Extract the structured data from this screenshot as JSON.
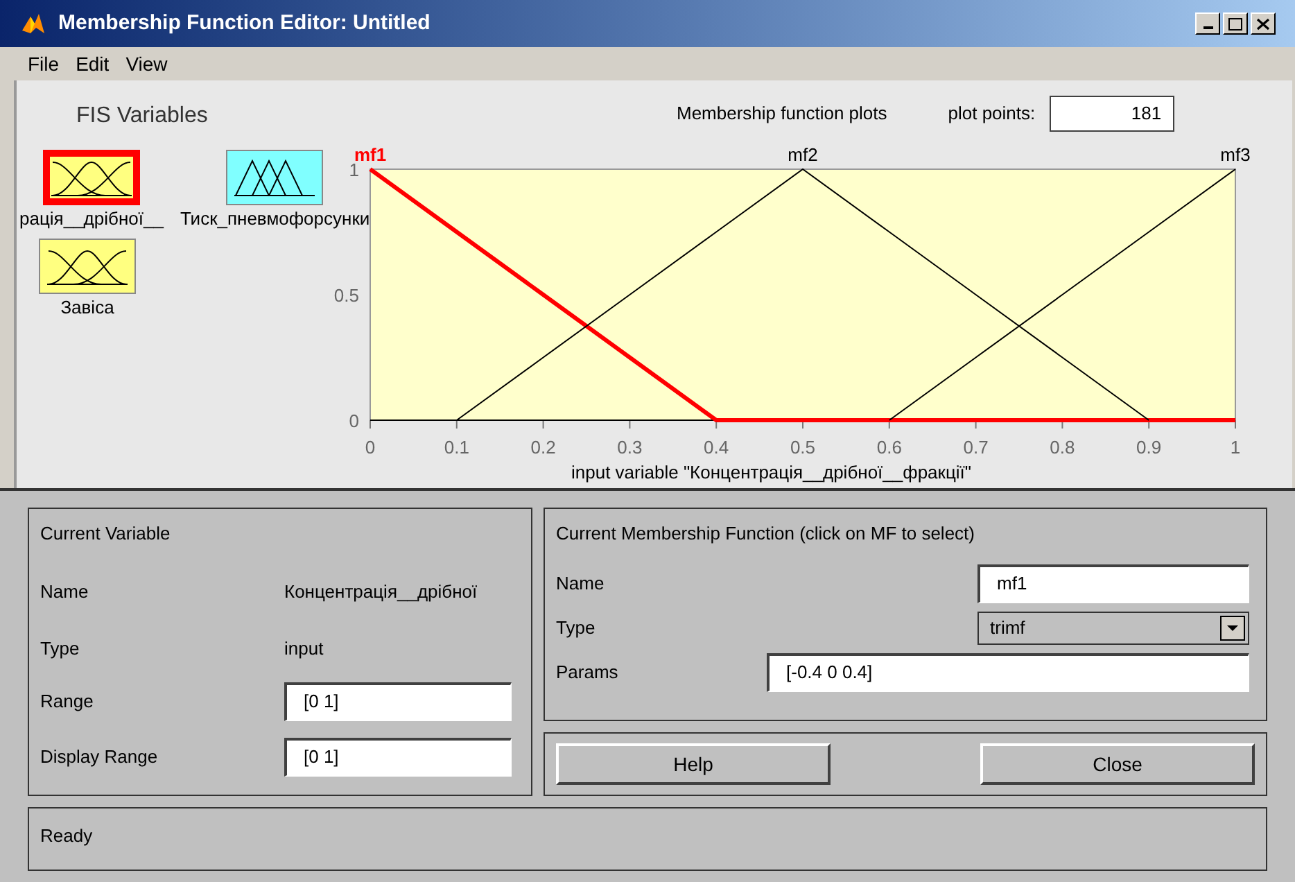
{
  "window": {
    "title": "Membership Function Editor: Untitled"
  },
  "menu": [
    "File",
    "Edit",
    "View"
  ],
  "fis_variables": {
    "title": "FIS Variables",
    "items": [
      {
        "label": "рація__дрібної__",
        "kind": "input",
        "selected": true
      },
      {
        "label": "Тиск_пневмофорсунки",
        "kind": "output",
        "selected": false
      },
      {
        "label": "Завіса",
        "kind": "input",
        "selected": false
      }
    ]
  },
  "plot": {
    "title": "Membership function plots",
    "points_label": "plot points:",
    "points": "181",
    "chart_data": {
      "type": "line",
      "xlabel": "input variable \"Концентрація__дрібної__фракції\"",
      "x": [
        0,
        0.1,
        0.2,
        0.3,
        0.4,
        0.5,
        0.6,
        0.7,
        0.8,
        0.9,
        1
      ],
      "xlim": [
        0,
        1
      ],
      "ylim": [
        0,
        1
      ],
      "xticks": [
        0,
        0.1,
        0.2,
        0.3,
        0.4,
        0.5,
        0.6,
        0.7,
        0.8,
        0.9,
        1
      ],
      "yticks": [
        0,
        0.5,
        1
      ],
      "series": [
        {
          "name": "mf1",
          "color": "#ff0000",
          "values": [
            1,
            0.75,
            0.5,
            0.25,
            0,
            0,
            0,
            0,
            0,
            0,
            0
          ]
        },
        {
          "name": "mf2",
          "color": "#000000",
          "values": [
            null,
            0,
            0.25,
            0.5,
            0.75,
            1,
            0.75,
            0.5,
            0.25,
            0,
            null
          ]
        },
        {
          "name": "mf3",
          "color": "#000000",
          "values": [
            null,
            null,
            null,
            null,
            null,
            null,
            0,
            0.25,
            0.5,
            0.75,
            1
          ]
        }
      ]
    },
    "curves": [
      {
        "selected": true
      },
      {
        "selected": false
      },
      {
        "selected": false
      }
    ]
  },
  "current_variable": {
    "title": "Current Variable",
    "name_label": "Name",
    "name": "Концентрація__дрібної",
    "type_label": "Type",
    "type": "input",
    "range_label": "Range",
    "range": "[0 1]",
    "display_range_label": "Display Range",
    "display_range": "[0 1]"
  },
  "current_mf": {
    "title": "Current Membership Function (click on MF to select)",
    "name_label": "Name",
    "name": "mf1",
    "type_label": "Type",
    "type": "trimf",
    "params_label": "Params",
    "params": "[-0.4 0 0.4]"
  },
  "buttons": [
    "Help",
    "Close"
  ],
  "status": "Ready"
}
